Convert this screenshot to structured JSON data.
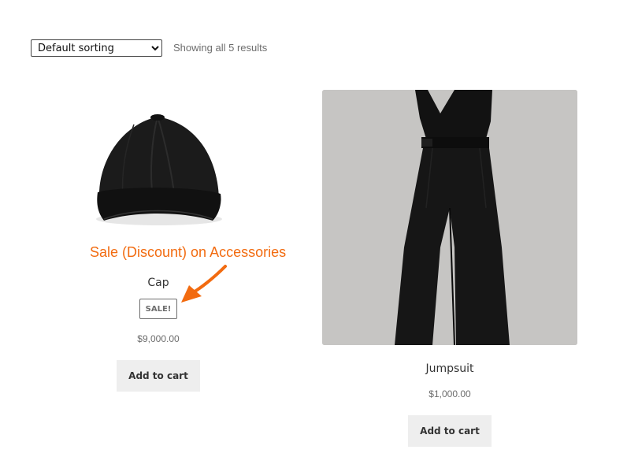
{
  "toolbar": {
    "sort_selected": "Default sorting",
    "sort_options": [
      "Default sorting"
    ],
    "result_count": "Showing all 5 results"
  },
  "annotation": {
    "text": "Sale (Discount) on Accessories",
    "color": "#f26b10"
  },
  "products": [
    {
      "title": "Cap",
      "badge": "SALE!",
      "price": "$9,000.00",
      "button": "Add to cart",
      "image_icon": "cap-icon"
    },
    {
      "title": "Jumpsuit",
      "price": "$1,000.00",
      "button": "Add to cart",
      "image_icon": "jumpsuit-icon"
    }
  ]
}
